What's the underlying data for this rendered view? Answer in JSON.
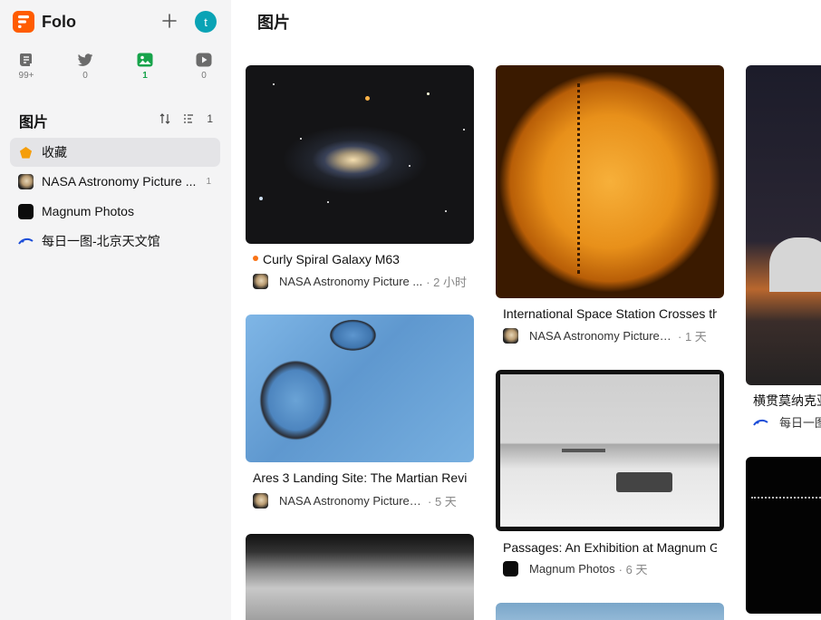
{
  "app": {
    "name": "Folo",
    "user_initial": "t"
  },
  "views": [
    {
      "icon": "article-icon",
      "count": "99+"
    },
    {
      "icon": "twitter-icon",
      "count": "0"
    },
    {
      "icon": "picture-icon",
      "count": "1"
    },
    {
      "icon": "video-icon",
      "count": "0"
    }
  ],
  "section": {
    "title": "图片",
    "count": "1"
  },
  "subscriptions": [
    {
      "label": "收藏",
      "count": ""
    },
    {
      "label": "NASA Astronomy Picture ...",
      "count": "1"
    },
    {
      "label": "Magnum Photos",
      "count": ""
    },
    {
      "label": "每日一图-北京天文馆",
      "count": ""
    }
  ],
  "main": {
    "title": "图片"
  },
  "entries": [
    {
      "title": "Curly Spiral Galaxy M63",
      "source": "NASA Astronomy Picture ...",
      "time": "· 2 小时",
      "unread": true
    },
    {
      "title": "Ares 3 Landing Site: The Martian Revis",
      "source": "NASA Astronomy Picture of...",
      "time": "· 5 天",
      "unread": false
    },
    {
      "title": "International Space Station Crosses th",
      "source": "NASA Astronomy Picture of ...",
      "time": "· 1 天",
      "unread": false
    },
    {
      "title": "Passages: An Exhibition at Magnum G",
      "source": "Magnum Photos",
      "time": "· 6 天",
      "unread": false
    },
    {
      "title": "横贯莫纳克亚",
      "source": "每日一图",
      "time": "",
      "unread": false
    }
  ],
  "colors": {
    "brand": "#ff5c00",
    "accent_green": "#16a34a",
    "avatar": "#0aa3b5",
    "unread_dot": "#f97316"
  }
}
